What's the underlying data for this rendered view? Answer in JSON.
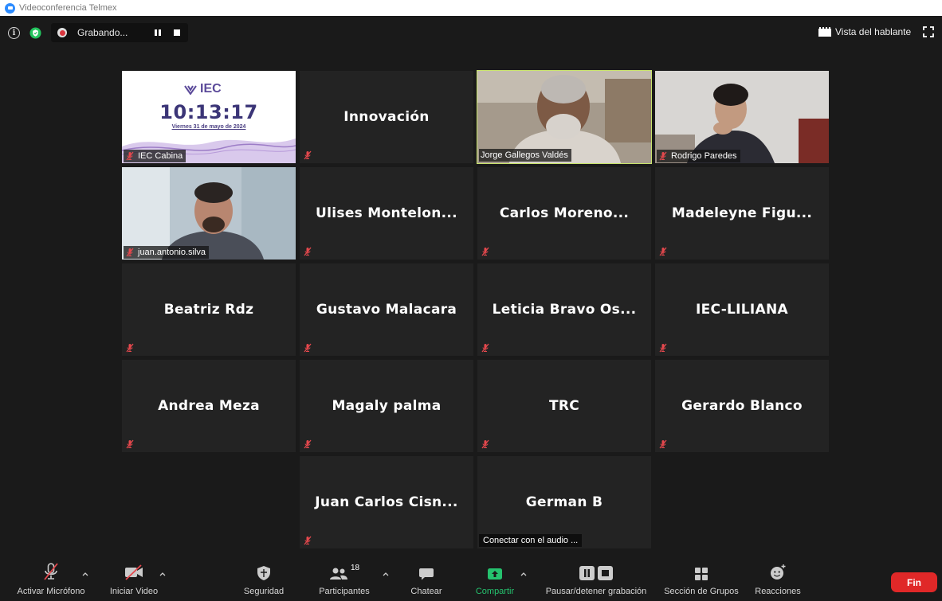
{
  "window": {
    "title": "Videoconferencia Telmex"
  },
  "topbar": {
    "recording_label": "Grabando...",
    "speaker_view_label": "Vista del hablante"
  },
  "tiles": {
    "iec_cabina": {
      "name": "IEC Cabina",
      "logo": "IEC",
      "clock": "10:13:17",
      "date": "Viernes 31 de mayo de 2024"
    },
    "innovacion": {
      "name": "Innovación"
    },
    "jorge": {
      "name": "Jorge Gallegos Valdés"
    },
    "rodrigo": {
      "name": "Rodrigo Paredes"
    },
    "juan_antonio": {
      "name": "juan.antonio.silva"
    },
    "ulises": {
      "name": "Ulises Montelon..."
    },
    "carlos": {
      "name": "Carlos Moreno..."
    },
    "madeleyne": {
      "name": "Madeleyne Figu..."
    },
    "beatriz": {
      "name": "Beatriz Rdz"
    },
    "gustavo": {
      "name": "Gustavo Malacara"
    },
    "leticia": {
      "name": "Leticia Bravo Os..."
    },
    "liliana": {
      "name": "IEC-LILIANA"
    },
    "andrea": {
      "name": "Andrea Meza"
    },
    "magaly": {
      "name": "Magaly palma"
    },
    "trc": {
      "name": "TRC"
    },
    "gerardo": {
      "name": "Gerardo Blanco"
    },
    "juan_carlos": {
      "name": "Juan Carlos Cisn..."
    },
    "german": {
      "name": "German B",
      "audio_prompt": "Conectar con el audio ..."
    }
  },
  "toolbar": {
    "mic_label": "Activar Micrófono",
    "video_label": "Iniciar Video",
    "security_label": "Seguridad",
    "participants_label": "Participantes",
    "participants_count": "18",
    "chat_label": "Chatear",
    "share_label": "Compartir",
    "record_label": "Pausar/detener grabación",
    "breakout_label": "Sección de Grupos",
    "reactions_label": "Reacciones",
    "end_label": "Fin"
  },
  "colors": {
    "background": "#1a1a1a",
    "tile": "#232323",
    "active_speaker": "#c7e36b",
    "share_green": "#25c26e",
    "end_red": "#e02828",
    "muted_red": "#e5484d"
  }
}
